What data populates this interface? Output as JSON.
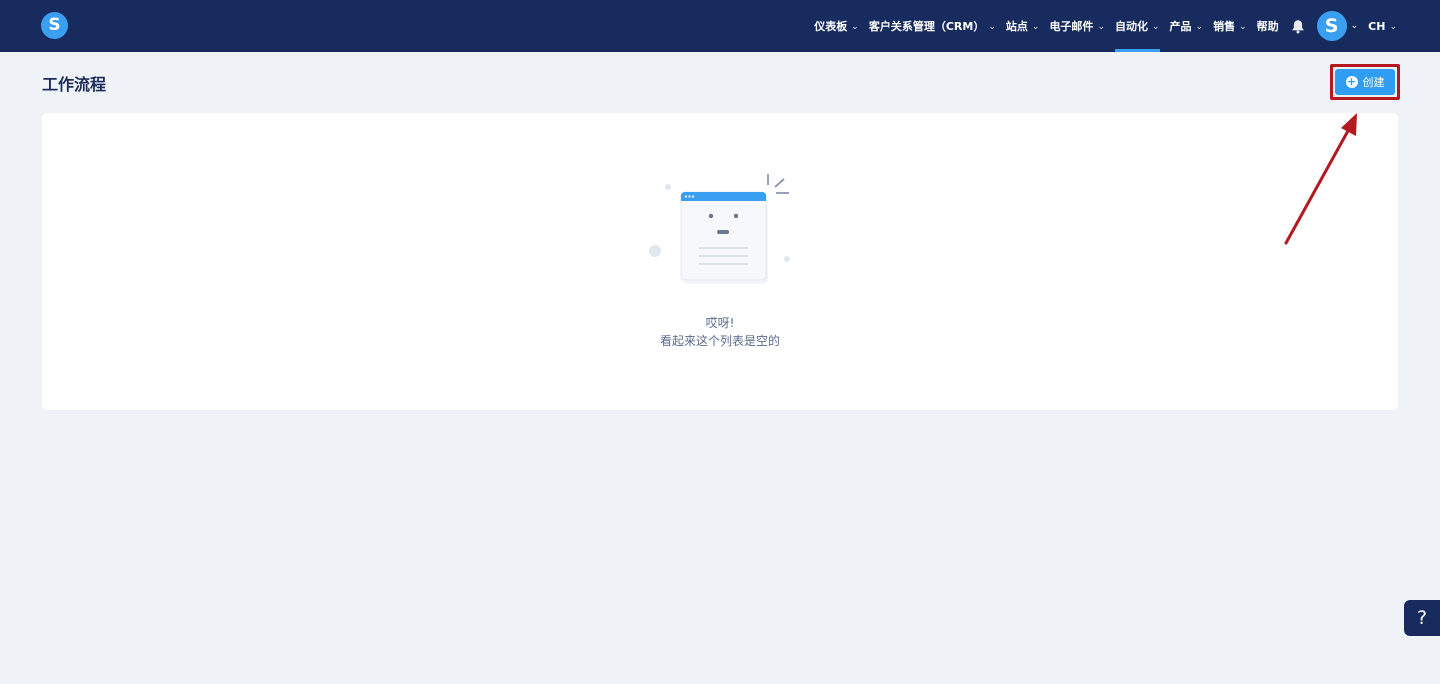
{
  "app": {
    "logo_letter": "S"
  },
  "nav": {
    "items": [
      {
        "label": "仪表板",
        "has_dropdown": true,
        "active": false
      },
      {
        "label": "客户关系管理（CRM）",
        "has_dropdown": true,
        "active": false
      },
      {
        "label": "站点",
        "has_dropdown": true,
        "active": false
      },
      {
        "label": "电子邮件",
        "has_dropdown": true,
        "active": false
      },
      {
        "label": "自动化",
        "has_dropdown": true,
        "active": true
      },
      {
        "label": "产品",
        "has_dropdown": true,
        "active": false
      },
      {
        "label": "销售",
        "has_dropdown": true,
        "active": false
      },
      {
        "label": "帮助",
        "has_dropdown": false,
        "active": false
      }
    ],
    "notifications_icon": "bell-icon",
    "avatar_letter": "S",
    "language": "CH"
  },
  "page": {
    "title": "工作流程"
  },
  "toolbar": {
    "create_label": "创建",
    "create_icon": "plus-circle-icon"
  },
  "empty_state": {
    "title": "哎呀!",
    "subtitle": "看起来这个列表是空的"
  },
  "help_button": {
    "label": "?"
  },
  "colors": {
    "topbar": "#172b5e",
    "accent": "#2f9ef2",
    "background": "#eff3f8",
    "highlight": "#b3191e"
  }
}
